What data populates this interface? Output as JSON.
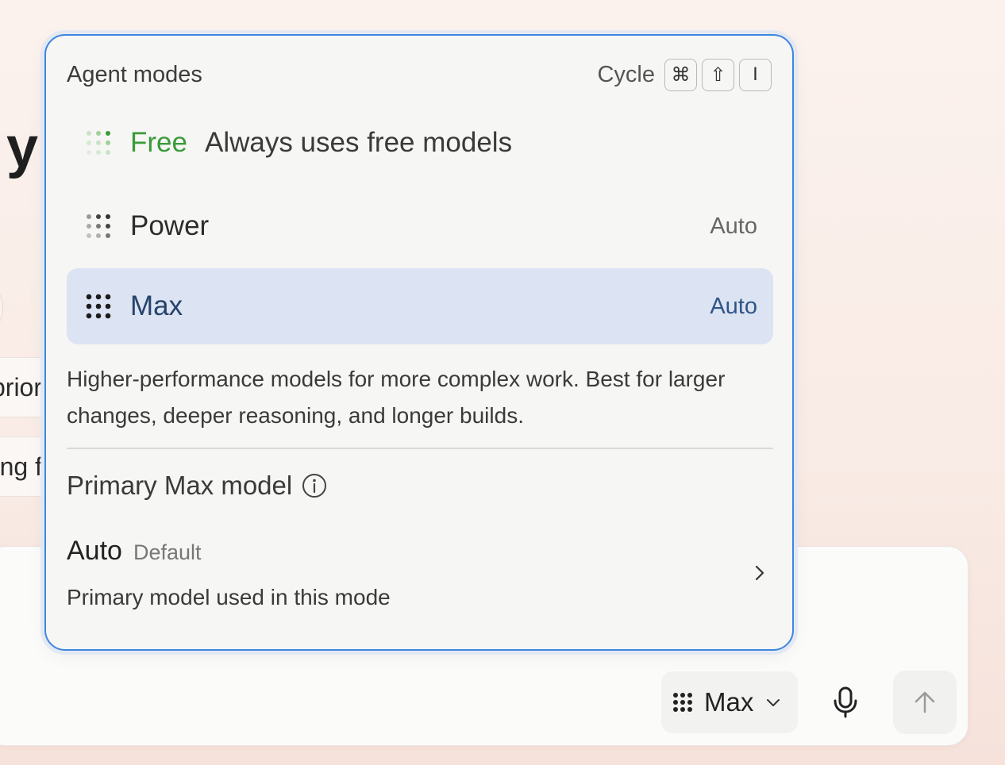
{
  "background": {
    "heading_fragment": "y",
    "chip_1": "prior",
    "chip_2": "ng f"
  },
  "popover": {
    "title": "Agent modes",
    "cycle_label": "Cycle",
    "shortcut_keys": [
      "⌘",
      "⇧",
      "I"
    ],
    "modes": [
      {
        "name": "Free",
        "description": "Always uses free models",
        "tag": "",
        "icon": "dots-grid-light-icon",
        "selected": false
      },
      {
        "name": "Power",
        "description": "",
        "tag": "Auto",
        "icon": "dots-grid-medium-icon",
        "selected": false
      },
      {
        "name": "Max",
        "description": "",
        "tag": "Auto",
        "icon": "dots-grid-full-icon",
        "selected": true
      }
    ],
    "selected_mode_explanation": "Higher-performance models for more complex work. Best for larger changes, deeper reasoning, and longer builds.",
    "primary_model_title": "Primary Max model",
    "primary_model": {
      "name": "Auto",
      "badge": "Default",
      "subtitle": "Primary model used in this mode"
    }
  },
  "composer": {
    "mode_selector_label": "Max"
  },
  "colors": {
    "popover_border": "#3f85e0",
    "selected_row_bg": "#dce3f2",
    "free_accent": "#3a9a3a",
    "max_text": "#25436b"
  }
}
